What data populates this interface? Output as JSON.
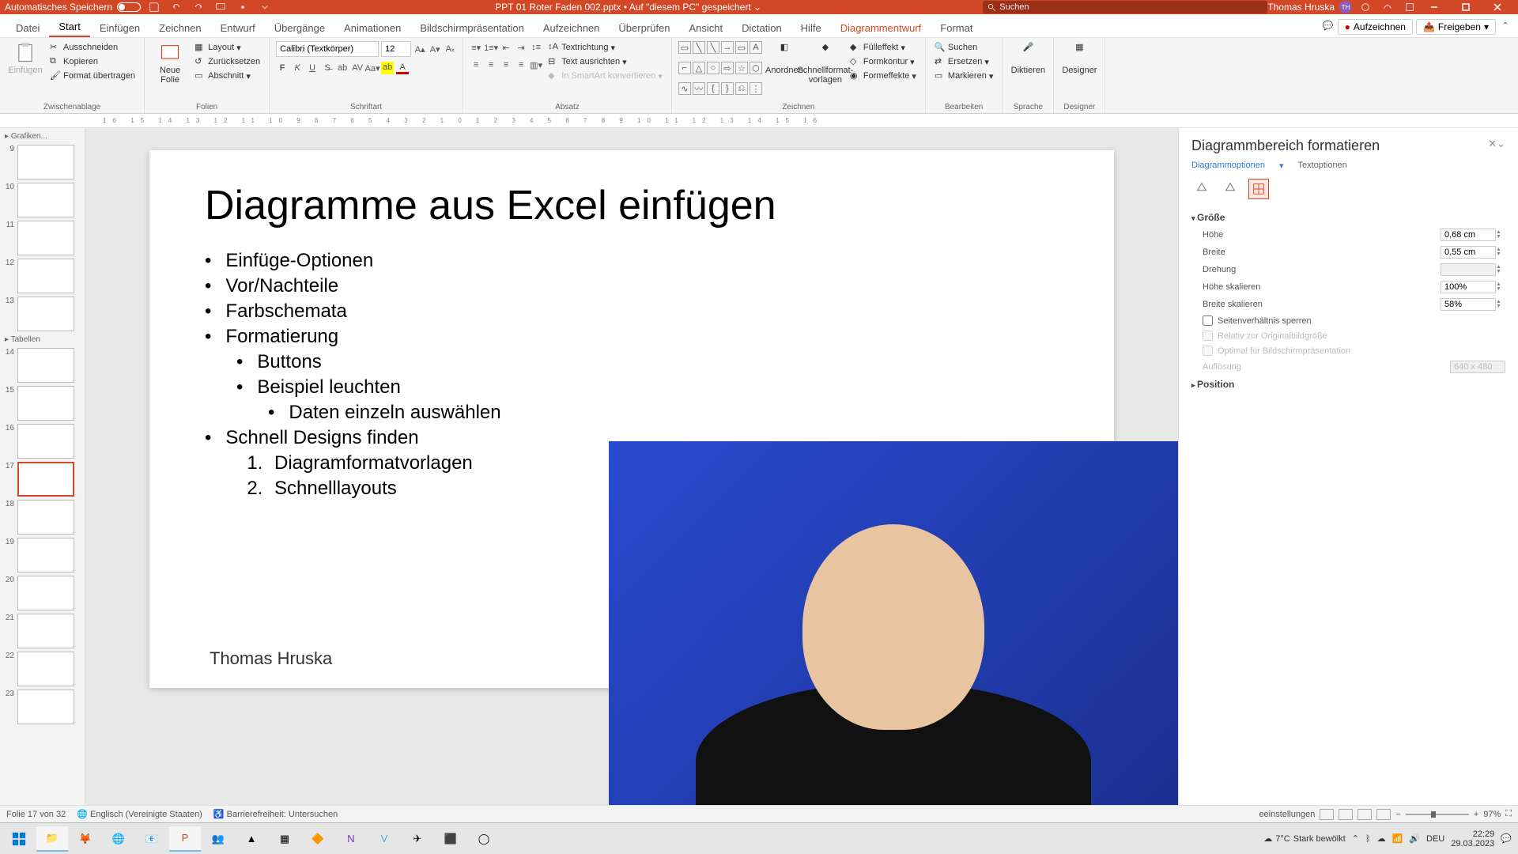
{
  "titlebar": {
    "autosave": "Automatisches Speichern",
    "filename": "PPT 01 Roter Faden 002.pptx",
    "saved_status": "Auf \"diesem PC\" gespeichert",
    "search_placeholder": "Suchen",
    "user_name": "Thomas Hruska",
    "user_initials": "TH"
  },
  "tabs": {
    "items": [
      "Datei",
      "Start",
      "Einfügen",
      "Zeichnen",
      "Entwurf",
      "Übergänge",
      "Animationen",
      "Bildschirmpräsentation",
      "Aufzeichnen",
      "Überprüfen",
      "Ansicht",
      "Dictation",
      "Hilfe",
      "Diagrammentwurf",
      "Format"
    ],
    "active": "Start",
    "record": "Aufzeichnen",
    "share": "Freigeben"
  },
  "ribbon": {
    "clipboard": {
      "label": "Zwischenablage",
      "paste": "Einfügen",
      "cut": "Ausschneiden",
      "copy": "Kopieren",
      "format_painter": "Format übertragen"
    },
    "slides": {
      "label": "Folien",
      "new": "Neue\nFolie",
      "layout": "Layout",
      "reset": "Zurücksetzen",
      "section": "Abschnitt"
    },
    "font": {
      "label": "Schriftart",
      "name": "Calibri (Textkörper)",
      "size": "12"
    },
    "paragraph": {
      "label": "Absatz",
      "text_dir": "Textrichtung",
      "align": "Text ausrichten",
      "smartart": "In SmartArt konvertieren"
    },
    "drawing": {
      "label": "Zeichnen",
      "arrange": "Anordnen",
      "quick_styles": "Schnellformat-\nvorlagen",
      "shape_fill": "Fülleffekt",
      "shape_outline": "Formkontur",
      "shape_effects": "Formeffekte"
    },
    "editing": {
      "label": "Bearbeiten",
      "find": "Suchen",
      "replace": "Ersetzen",
      "select": "Markieren"
    },
    "voice": {
      "label": "Sprache",
      "dictate": "Diktieren"
    },
    "designer": {
      "label": "Designer",
      "btn": "Designer"
    }
  },
  "ruler": "16   15   14   13   12   11   10   9   8   7   6   5   4   3   2   1   0   1   2   3   4   5   6   7   8   9   10   11   12   13   14   15   16",
  "thumbs": {
    "section1": "Grafiken...",
    "section2": "Tabellen",
    "nums": [
      "9",
      "10",
      "11",
      "12",
      "13",
      "14",
      "15",
      "16",
      "17",
      "18",
      "19",
      "20",
      "21",
      "22",
      "23"
    ],
    "selected": "17"
  },
  "slide": {
    "title": "Diagramme aus Excel einfügen",
    "bullets": [
      "Einfüge-Optionen",
      "Vor/Nachteile",
      "Farbschemata",
      "Formatierung"
    ],
    "sub_bullets": [
      "Buttons",
      "Beispiel leuchten"
    ],
    "subsub": [
      "Daten einzeln auswählen"
    ],
    "bullet5": "Schnell Designs finden",
    "ol": [
      "Diagramformatvorlagen",
      "Schnelllayouts"
    ],
    "footer": "Thomas Hruska"
  },
  "pane": {
    "title": "Diagrammbereich formatieren",
    "tab1": "Diagrammoptionen",
    "tab2": "Textoptionen",
    "sect_size": "Größe",
    "height": "Höhe",
    "height_v": "0,68 cm",
    "width": "Breite",
    "width_v": "0,55 cm",
    "rotation": "Drehung",
    "scale_h": "Höhe skalieren",
    "scale_h_v": "100%",
    "scale_w": "Breite skalieren",
    "scale_w_v": "58%",
    "lock": "Seitenverhältnis sperren",
    "rel_orig": "Relativ zur Originalbildgröße",
    "optimal": "Optimal für Bildschirmpräsentation",
    "resolution": "Auflösung",
    "resolution_v": "640 x 480",
    "sect_pos": "Position"
  },
  "status": {
    "slide": "Folie 17 von 32",
    "lang": "Englisch (Vereinigte Staaten)",
    "a11y": "Barrierefreiheit: Untersuchen",
    "settings": "eeinstellungen",
    "zoom": "97%"
  },
  "taskbar": {
    "weather_temp": "7°C",
    "weather_desc": "Stark bewölkt",
    "lang": "DEU",
    "time": "22:29",
    "date": "29.03.2023"
  }
}
